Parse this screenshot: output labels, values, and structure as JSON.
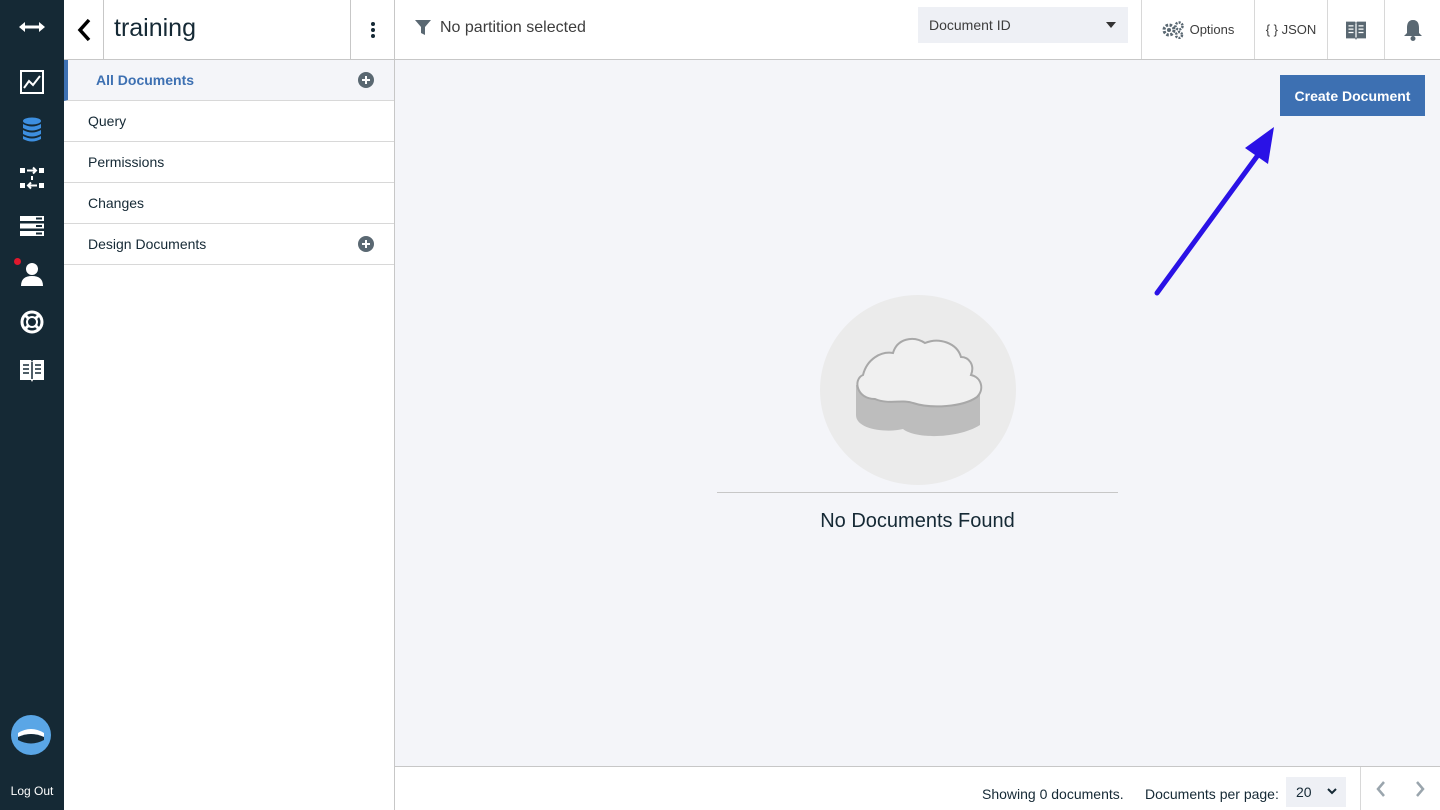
{
  "rail": {
    "items": [
      "expand-icon",
      "activity-chart-icon",
      "database-icon",
      "replication-icon",
      "server-icon",
      "user-icon",
      "help-lifebuoy-icon",
      "documentation-book-icon"
    ],
    "logout_label": "Log Out"
  },
  "sidebar": {
    "db_name": "training",
    "items": [
      {
        "label": "All Documents",
        "active": true,
        "has_add": true
      },
      {
        "label": "Query"
      },
      {
        "label": "Permissions"
      },
      {
        "label": "Changes"
      },
      {
        "label": "Design Documents",
        "has_add": true
      }
    ]
  },
  "topbar": {
    "partition_label": "No partition selected",
    "select_value": "Document ID",
    "options_label": "Options",
    "json_label": "{ } JSON"
  },
  "main": {
    "create_button": "Create Document",
    "empty_message": "No Documents Found"
  },
  "footer": {
    "showing": "Showing 0 documents.",
    "per_page_label": "Documents per page:",
    "per_page_value": "20"
  },
  "colors": {
    "rail": "#152935",
    "accent": "#3d70b2",
    "annotation_arrow": "#2a12e6"
  }
}
